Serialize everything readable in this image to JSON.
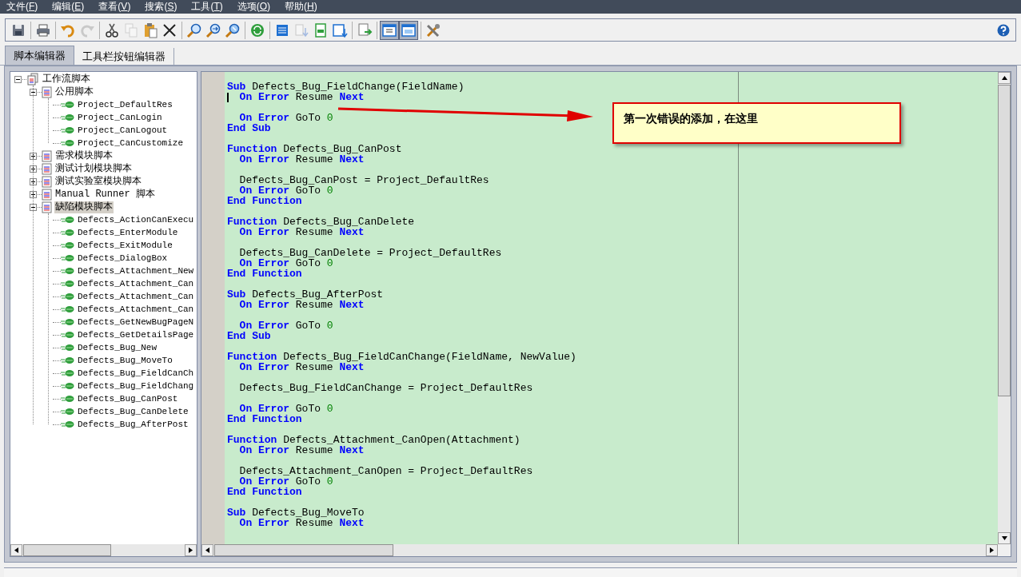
{
  "menu": [
    {
      "before": "文件(",
      "key": "F",
      "after": ")"
    },
    {
      "before": "编辑(",
      "key": "E",
      "after": ")"
    },
    {
      "before": "查看(",
      "key": "V",
      "after": ")"
    },
    {
      "before": "搜索(",
      "key": "S",
      "after": ")"
    },
    {
      "before": "工具(",
      "key": "T",
      "after": ")"
    },
    {
      "before": "选项(",
      "key": "O",
      "after": ")"
    },
    {
      "before": "帮助(",
      "key": "H",
      "after": ")"
    }
  ],
  "toolbar": {
    "groups": [
      [
        {
          "pressed": false,
          "disabled": false
        }
      ],
      [
        {
          "pressed": false,
          "disabled": false
        }
      ],
      [
        {
          "pressed": false,
          "disabled": false
        },
        {
          "pressed": false,
          "disabled": true
        }
      ],
      [
        {
          "pressed": false,
          "disabled": false
        },
        {
          "pressed": false,
          "disabled": true
        },
        {
          "pressed": false,
          "disabled": false
        },
        {
          "pressed": false,
          "disabled": false
        }
      ],
      [
        {
          "pressed": false,
          "disabled": false
        },
        {
          "pressed": false,
          "disabled": false
        },
        {
          "pressed": false,
          "disabled": false
        }
      ],
      [
        {
          "pressed": false,
          "disabled": false
        }
      ],
      [
        {
          "pressed": false,
          "disabled": false
        },
        {
          "pressed": false,
          "disabled": true
        },
        {
          "pressed": false,
          "disabled": false
        },
        {
          "pressed": false,
          "disabled": false
        }
      ],
      [
        {
          "pressed": false,
          "disabled": false
        }
      ],
      [
        {
          "pressed": true,
          "disabled": false
        },
        {
          "pressed": true,
          "disabled": false
        }
      ],
      [
        {
          "pressed": false,
          "disabled": false
        }
      ]
    ]
  },
  "tabs": [
    {
      "label": "脚本编辑器",
      "selected": true
    },
    {
      "label": "工具栏按钮编辑器",
      "selected": false
    }
  ],
  "tree": [
    {
      "label": "工作流脚本",
      "kind": "folder",
      "expanded": true,
      "selected": false,
      "children": [
        {
          "label": "公用脚本",
          "kind": "script",
          "expanded": true,
          "selected": false,
          "children": [
            {
              "label": "Project_DefaultRes",
              "kind": "procedure",
              "selected": false
            },
            {
              "label": "Project_CanLogin",
              "kind": "procedure",
              "selected": false
            },
            {
              "label": "Project_CanLogout",
              "kind": "procedure",
              "selected": false
            },
            {
              "label": "Project_CanCustomize",
              "kind": "procedure",
              "selected": false
            }
          ]
        },
        {
          "label": "需求模块脚本",
          "kind": "script",
          "expanded": false,
          "selected": false
        },
        {
          "label": "测试计划模块脚本",
          "kind": "script",
          "expanded": false,
          "selected": false
        },
        {
          "label": "测试实验室模块脚本",
          "kind": "script",
          "expanded": false,
          "selected": false
        },
        {
          "label": "Manual Runner 脚本",
          "kind": "script",
          "expanded": false,
          "selected": false
        },
        {
          "label": "缺陷模块脚本",
          "kind": "script",
          "expanded": true,
          "selected": true,
          "children": [
            {
              "label": "Defects_ActionCanExecu",
              "kind": "procedure",
              "selected": false
            },
            {
              "label": "Defects_EnterModule",
              "kind": "procedure",
              "selected": false
            },
            {
              "label": "Defects_ExitModule",
              "kind": "procedure",
              "selected": false
            },
            {
              "label": "Defects_DialogBox",
              "kind": "procedure",
              "selected": false
            },
            {
              "label": "Defects_Attachment_New",
              "kind": "procedure",
              "selected": false
            },
            {
              "label": "Defects_Attachment_Can",
              "kind": "procedure",
              "selected": false
            },
            {
              "label": "Defects_Attachment_Can",
              "kind": "procedure",
              "selected": false
            },
            {
              "label": "Defects_Attachment_Can",
              "kind": "procedure",
              "selected": false
            },
            {
              "label": "Defects_GetNewBugPageN",
              "kind": "procedure",
              "selected": false
            },
            {
              "label": "Defects_GetDetailsPage",
              "kind": "procedure",
              "selected": false
            },
            {
              "label": "Defects_Bug_New",
              "kind": "procedure",
              "selected": false
            },
            {
              "label": "Defects_Bug_MoveTo",
              "kind": "procedure",
              "selected": false
            },
            {
              "label": "Defects_Bug_FieldCanCh",
              "kind": "procedure",
              "selected": false
            },
            {
              "label": "Defects_Bug_FieldChang",
              "kind": "procedure",
              "selected": false
            },
            {
              "label": "Defects_Bug_CanPost",
              "kind": "procedure",
              "selected": false
            },
            {
              "label": "Defects_Bug_CanDelete",
              "kind": "procedure",
              "selected": false
            },
            {
              "label": "Defects_Bug_AfterPost",
              "kind": "procedure",
              "selected": false
            }
          ]
        }
      ]
    }
  ],
  "code": [
    {
      "kind": "code",
      "tokens": [
        {
          "kind": "kw",
          "text": "Sub"
        },
        {
          "kind": "text",
          "text": " Defects_Bug_FieldChange(FieldName)"
        }
      ]
    },
    {
      "kind": "code",
      "cursor": true,
      "tokens": [
        {
          "kind": "kw",
          "text": "  On Error"
        },
        {
          "kind": "text",
          "text": " Resume "
        },
        {
          "kind": "kw",
          "text": "Next"
        }
      ]
    },
    {
      "kind": "blank"
    },
    {
      "kind": "code",
      "tokens": [
        {
          "kind": "kw",
          "text": "  On Error"
        },
        {
          "kind": "text",
          "text": " GoTo "
        },
        {
          "kind": "num",
          "text": "0"
        }
      ]
    },
    {
      "kind": "code",
      "tokens": [
        {
          "kind": "kw",
          "text": "End Sub"
        }
      ]
    },
    {
      "kind": "blank"
    },
    {
      "kind": "code",
      "tokens": [
        {
          "kind": "kw",
          "text": "Function"
        },
        {
          "kind": "text",
          "text": " Defects_Bug_CanPost"
        }
      ]
    },
    {
      "kind": "code",
      "tokens": [
        {
          "kind": "kw",
          "text": "  On Error"
        },
        {
          "kind": "text",
          "text": " Resume "
        },
        {
          "kind": "kw",
          "text": "Next"
        }
      ]
    },
    {
      "kind": "blank"
    },
    {
      "kind": "code",
      "tokens": [
        {
          "kind": "text",
          "text": "  Defects_Bug_CanPost = Project_DefaultRes"
        }
      ]
    },
    {
      "kind": "code",
      "tokens": [
        {
          "kind": "kw",
          "text": "  On Error"
        },
        {
          "kind": "text",
          "text": " GoTo "
        },
        {
          "kind": "num",
          "text": "0"
        }
      ]
    },
    {
      "kind": "code",
      "tokens": [
        {
          "kind": "kw",
          "text": "End Function"
        }
      ]
    },
    {
      "kind": "blank"
    },
    {
      "kind": "code",
      "tokens": [
        {
          "kind": "kw",
          "text": "Function"
        },
        {
          "kind": "text",
          "text": " Defects_Bug_CanDelete"
        }
      ]
    },
    {
      "kind": "code",
      "tokens": [
        {
          "kind": "kw",
          "text": "  On Error"
        },
        {
          "kind": "text",
          "text": " Resume "
        },
        {
          "kind": "kw",
          "text": "Next"
        }
      ]
    },
    {
      "kind": "blank"
    },
    {
      "kind": "code",
      "tokens": [
        {
          "kind": "text",
          "text": "  Defects_Bug_CanDelete = Project_DefaultRes"
        }
      ]
    },
    {
      "kind": "code",
      "tokens": [
        {
          "kind": "kw",
          "text": "  On Error"
        },
        {
          "kind": "text",
          "text": " GoTo "
        },
        {
          "kind": "num",
          "text": "0"
        }
      ]
    },
    {
      "kind": "code",
      "tokens": [
        {
          "kind": "kw",
          "text": "End Function"
        }
      ]
    },
    {
      "kind": "blank"
    },
    {
      "kind": "code",
      "tokens": [
        {
          "kind": "kw",
          "text": "Sub"
        },
        {
          "kind": "text",
          "text": " Defects_Bug_AfterPost"
        }
      ]
    },
    {
      "kind": "code",
      "tokens": [
        {
          "kind": "kw",
          "text": "  On Error"
        },
        {
          "kind": "text",
          "text": " Resume "
        },
        {
          "kind": "kw",
          "text": "Next"
        }
      ]
    },
    {
      "kind": "blank"
    },
    {
      "kind": "code",
      "tokens": [
        {
          "kind": "kw",
          "text": "  On Error"
        },
        {
          "kind": "text",
          "text": " GoTo "
        },
        {
          "kind": "num",
          "text": "0"
        }
      ]
    },
    {
      "kind": "code",
      "tokens": [
        {
          "kind": "kw",
          "text": "End Sub"
        }
      ]
    },
    {
      "kind": "blank"
    },
    {
      "kind": "code",
      "tokens": [
        {
          "kind": "kw",
          "text": "Function"
        },
        {
          "kind": "text",
          "text": " Defects_Bug_FieldCanChange(FieldName, NewValue)"
        }
      ]
    },
    {
      "kind": "code",
      "tokens": [
        {
          "kind": "kw",
          "text": "  On Error"
        },
        {
          "kind": "text",
          "text": " Resume "
        },
        {
          "kind": "kw",
          "text": "Next"
        }
      ]
    },
    {
      "kind": "blank"
    },
    {
      "kind": "code",
      "tokens": [
        {
          "kind": "text",
          "text": "  Defects_Bug_FieldCanChange = Project_DefaultRes"
        }
      ]
    },
    {
      "kind": "blank"
    },
    {
      "kind": "code",
      "tokens": [
        {
          "kind": "kw",
          "text": "  On Error"
        },
        {
          "kind": "text",
          "text": " GoTo "
        },
        {
          "kind": "num",
          "text": "0"
        }
      ]
    },
    {
      "kind": "code",
      "tokens": [
        {
          "kind": "kw",
          "text": "End Function"
        }
      ]
    },
    {
      "kind": "blank"
    },
    {
      "kind": "code",
      "tokens": [
        {
          "kind": "kw",
          "text": "Function"
        },
        {
          "kind": "text",
          "text": " Defects_Attachment_CanOpen(Attachment)"
        }
      ]
    },
    {
      "kind": "code",
      "tokens": [
        {
          "kind": "kw",
          "text": "  On Error"
        },
        {
          "kind": "text",
          "text": " Resume "
        },
        {
          "kind": "kw",
          "text": "Next"
        }
      ]
    },
    {
      "kind": "blank"
    },
    {
      "kind": "code",
      "tokens": [
        {
          "kind": "text",
          "text": "  Defects_Attachment_CanOpen = Project_DefaultRes"
        }
      ]
    },
    {
      "kind": "code",
      "tokens": [
        {
          "kind": "kw",
          "text": "  On Error"
        },
        {
          "kind": "text",
          "text": " GoTo "
        },
        {
          "kind": "num",
          "text": "0"
        }
      ]
    },
    {
      "kind": "code",
      "tokens": [
        {
          "kind": "kw",
          "text": "End Function"
        }
      ]
    },
    {
      "kind": "blank"
    },
    {
      "kind": "code",
      "tokens": [
        {
          "kind": "kw",
          "text": "Sub"
        },
        {
          "kind": "text",
          "text": " Defects_Bug_MoveTo"
        }
      ]
    },
    {
      "kind": "code",
      "tokens": [
        {
          "kind": "kw",
          "text": "  On Error"
        },
        {
          "kind": "text",
          "text": " Resume "
        },
        {
          "kind": "kw",
          "text": "Next"
        }
      ]
    },
    {
      "kind": "blank"
    }
  ],
  "callout": {
    "text": "第一次错误的添加，在这里"
  }
}
